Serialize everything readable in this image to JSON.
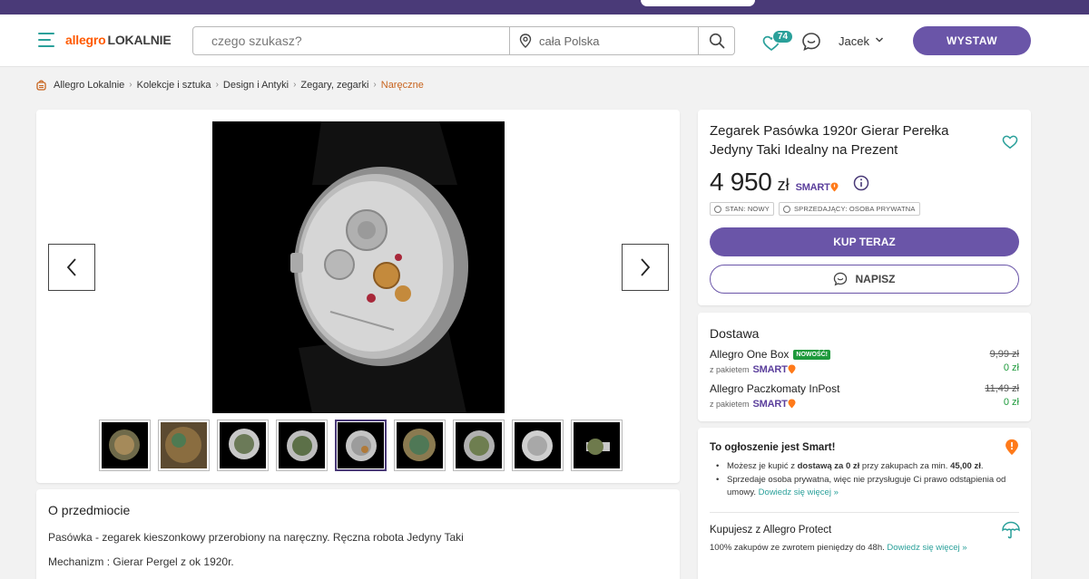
{
  "header": {
    "logo_part1": "allegro",
    "logo_part2": "LOKALNIE",
    "search_placeholder": "czego szukasz?",
    "location": "cała Polska",
    "fav_count": "74",
    "user_name": "Jacek",
    "wystaw_label": "WYSTAW"
  },
  "breadcrumb": [
    "Allegro Lokalnie",
    "Kolekcje i sztuka",
    "Design i Antyki",
    "Zegary, zegarki",
    "Naręczne"
  ],
  "gallery": {
    "thumb_count": 9,
    "active_thumb": 4
  },
  "offer": {
    "title": "Zegarek Pasówka 1920r Gierar Perełka Jedyny Taki Idealny na Prezent",
    "price": "4 950",
    "currency": "zł",
    "smart_label": "SMART",
    "chip_stan": "STAN: NOWY",
    "chip_seller": "SPRZEDAJĄCY: OSOBA PRYWATNA",
    "buy_label": "KUP TERAZ",
    "message_label": "NAPISZ"
  },
  "delivery": {
    "title": "Dostawa",
    "options": [
      {
        "name": "Allegro One Box",
        "badge": "NOWOŚĆ!",
        "package": "z pakietem",
        "old_price": "9,99 zł",
        "new_price": "0 zł"
      },
      {
        "name": "Allegro Paczkomaty InPost",
        "badge": "",
        "package": "z pakietem",
        "old_price": "11,49 zł",
        "new_price": "0 zł"
      }
    ]
  },
  "smart_info": {
    "title": "To ogłoszenie jest Smart!",
    "line1_a": "Możesz je kupić z ",
    "line1_b": "dostawą za 0 zł",
    "line1_c": " przy zakupach za min. ",
    "line1_d": "45,00 zł",
    "line1_e": ".",
    "line2": "Sprzedaje osoba prywatna, więc nie przysługuje Ci prawo odstąpienia od umowy. ",
    "link": "Dowiedz się więcej »",
    "protect_title": "Kupujesz z Allegro Protect",
    "protect_text": "100% zakupów ze zwrotem pieniędzy do 48h. ",
    "protect_link": "Dowiedz się więcej »"
  },
  "about": {
    "title": "O przedmiocie",
    "p1": "Pasówka - zegarek kieszonkowy przerobiony na naręczny. Ręczna robota Jedyny Taki",
    "p2": "Mechanizm : Gierar Pergel z ok 1920r."
  },
  "colors": {
    "accent": "#6a55a8",
    "teal": "#2aa09a",
    "orange": "#ff5a00",
    "green": "#1e9a3c"
  }
}
